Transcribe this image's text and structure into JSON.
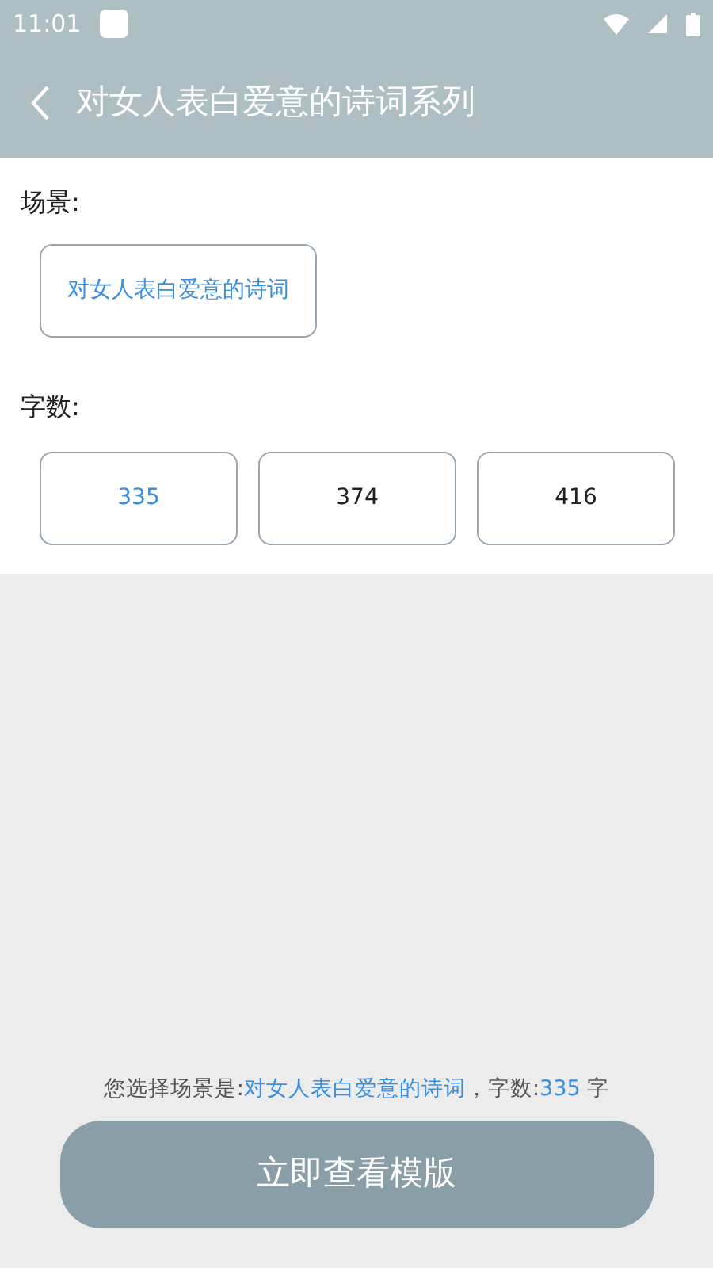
{
  "status_bar": {
    "time": "11:01"
  },
  "header": {
    "title": "对女人表白爱意的诗词系列"
  },
  "scene": {
    "label": "场景:",
    "options": [
      {
        "label": "对女人表白爱意的诗词",
        "selected": true
      }
    ]
  },
  "word_count": {
    "label": "字数:",
    "options": [
      {
        "label": "335",
        "selected": true
      },
      {
        "label": "374",
        "selected": false
      },
      {
        "label": "416",
        "selected": false
      }
    ]
  },
  "summary": {
    "parts": [
      {
        "text": "您选择场景是:",
        "highlight": false
      },
      {
        "text": "对女人表白爱意的诗词",
        "highlight": true
      },
      {
        "text": "，字数:",
        "highlight": false
      },
      {
        "text": "335",
        "highlight": true
      },
      {
        "text": " 字",
        "highlight": false
      }
    ]
  },
  "button": {
    "label": "立即查看模版"
  }
}
